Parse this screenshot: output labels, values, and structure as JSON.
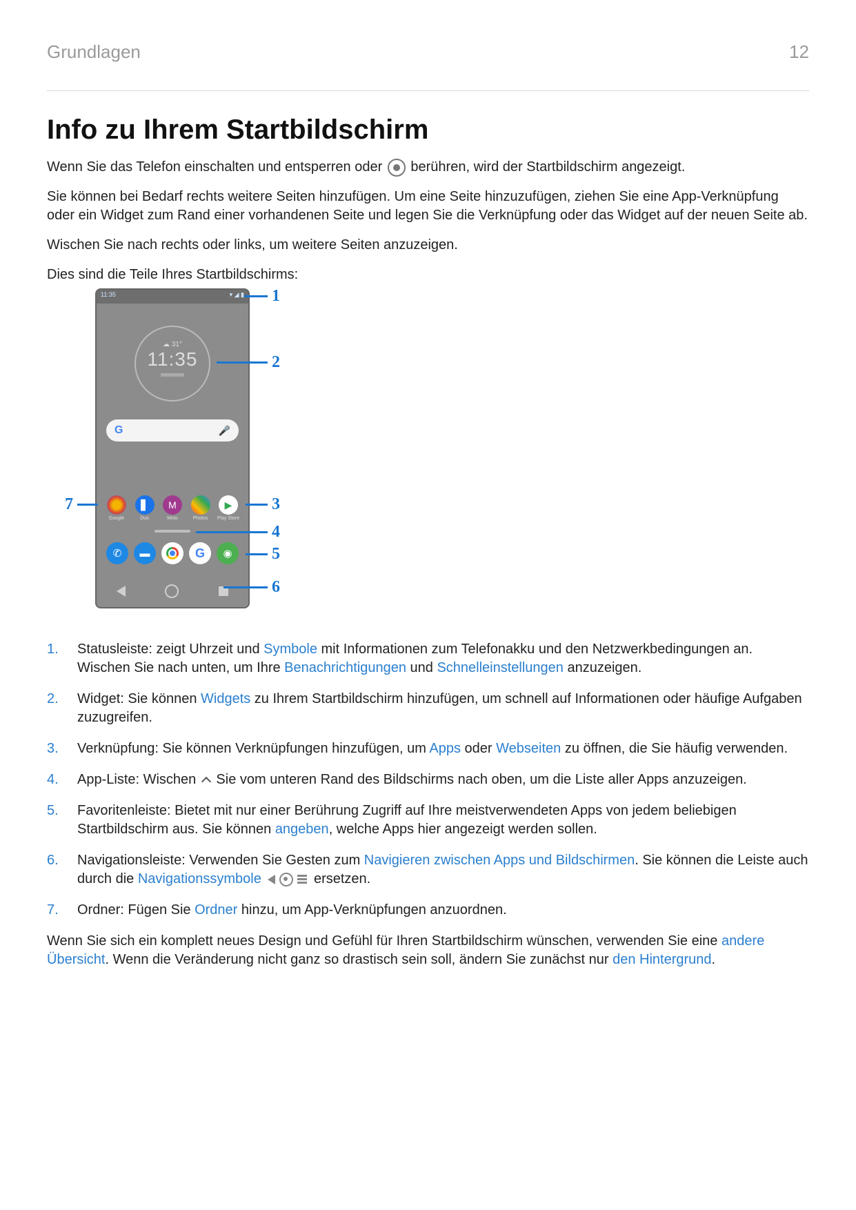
{
  "header": {
    "section": "Grundlagen",
    "page": "12"
  },
  "title": "Info zu Ihrem Startbildschirm",
  "intro": {
    "p1a": "Wenn Sie das Telefon einschalten und entsperren oder ",
    "p1b": " berühren, wird der Startbildschirm angezeigt.",
    "p2": "Sie können bei Bedarf rechts weitere Seiten hinzufügen. Um eine Seite hinzuzufügen, ziehen Sie eine App-Verknüpfung oder ein Widget zum Rand einer vorhandenen Seite und legen Sie die Verknüpfung oder das Widget auf der neuen Seite ab.",
    "p3": "Wischen Sie nach rechts oder links, um weitere Seiten anzuzeigen.",
    "p4": "Dies sind die Teile Ihres Startbildschirms:"
  },
  "diagram": {
    "status_time": "11:35",
    "clock_weather": "☁ 31°",
    "clock_time": "11:35",
    "search_g": "G",
    "apps": [
      "Google",
      "Duo",
      "Moto",
      "Photos",
      "Play Store"
    ],
    "callouts": {
      "1": "1",
      "2": "2",
      "3": "3",
      "4": "4",
      "5": "5",
      "6": "6",
      "7": "7"
    }
  },
  "legend": [
    {
      "n": "1.",
      "parts": [
        {
          "t": "Statusleiste: zeigt Uhrzeit und "
        },
        {
          "t": "Symbole",
          "link": true
        },
        {
          "t": " mit Informationen zum Telefonakku und den Netzwerkbedingungen an. Wischen Sie nach unten, um Ihre "
        },
        {
          "t": "Benachrichtigungen",
          "link": true
        },
        {
          "t": " und "
        },
        {
          "t": "Schnelleinstellungen",
          "link": true
        },
        {
          "t": " anzuzeigen."
        }
      ]
    },
    {
      "n": "2.",
      "parts": [
        {
          "t": "Widget: Sie können "
        },
        {
          "t": "Widgets",
          "link": true
        },
        {
          "t": " zu Ihrem Startbildschirm hinzufügen, um schnell auf Informationen oder häufige Aufgaben zuzugreifen."
        }
      ]
    },
    {
      "n": "3.",
      "parts": [
        {
          "t": "Verknüpfung: Sie können Verknüpfungen hinzufügen, um "
        },
        {
          "t": "Apps",
          "link": true
        },
        {
          "t": " oder "
        },
        {
          "t": "Webseiten",
          "link": true
        },
        {
          "t": " zu öffnen, die Sie häufig verwenden."
        }
      ]
    },
    {
      "n": "4.",
      "parts": [
        {
          "t": "App-Liste: Wischen "
        },
        {
          "icon": "chevron-up"
        },
        {
          "t": " Sie vom unteren Rand des Bildschirms nach oben, um die Liste aller Apps anzuzeigen."
        }
      ]
    },
    {
      "n": "5.",
      "parts": [
        {
          "t": "Favoritenleiste: Bietet mit nur einer Berührung Zugriff auf Ihre meistverwendeten Apps von jedem beliebigen Startbildschirm aus. Sie können "
        },
        {
          "t": "angeben",
          "link": true
        },
        {
          "t": ", welche Apps hier angezeigt werden sollen."
        }
      ]
    },
    {
      "n": "6.",
      "parts": [
        {
          "t": "Navigationsleiste: Verwenden Sie Gesten zum "
        },
        {
          "t": "Navigieren zwischen Apps und Bildschirmen",
          "link": true
        },
        {
          "t": ". Sie können die Leiste auch durch die "
        },
        {
          "t": "Navigationssymbole",
          "link": true
        },
        {
          "t": " "
        },
        {
          "icon": "nav-icons"
        },
        {
          "t": " ersetzen."
        }
      ]
    },
    {
      "n": "7.",
      "parts": [
        {
          "t": "Ordner: Fügen Sie "
        },
        {
          "t": "Ordner",
          "link": true
        },
        {
          "t": " hinzu, um App-Verknüpfungen anzuordnen."
        }
      ]
    }
  ],
  "outro": {
    "a": "Wenn Sie sich ein komplett neues Design und Gefühl für Ihren Startbildschirm wünschen, verwenden Sie eine ",
    "link1": "andere Übersicht",
    "b": ". Wenn die Veränderung nicht ganz so drastisch sein soll, ändern Sie zunächst nur ",
    "link2": "den Hintergrund",
    "c": "."
  }
}
